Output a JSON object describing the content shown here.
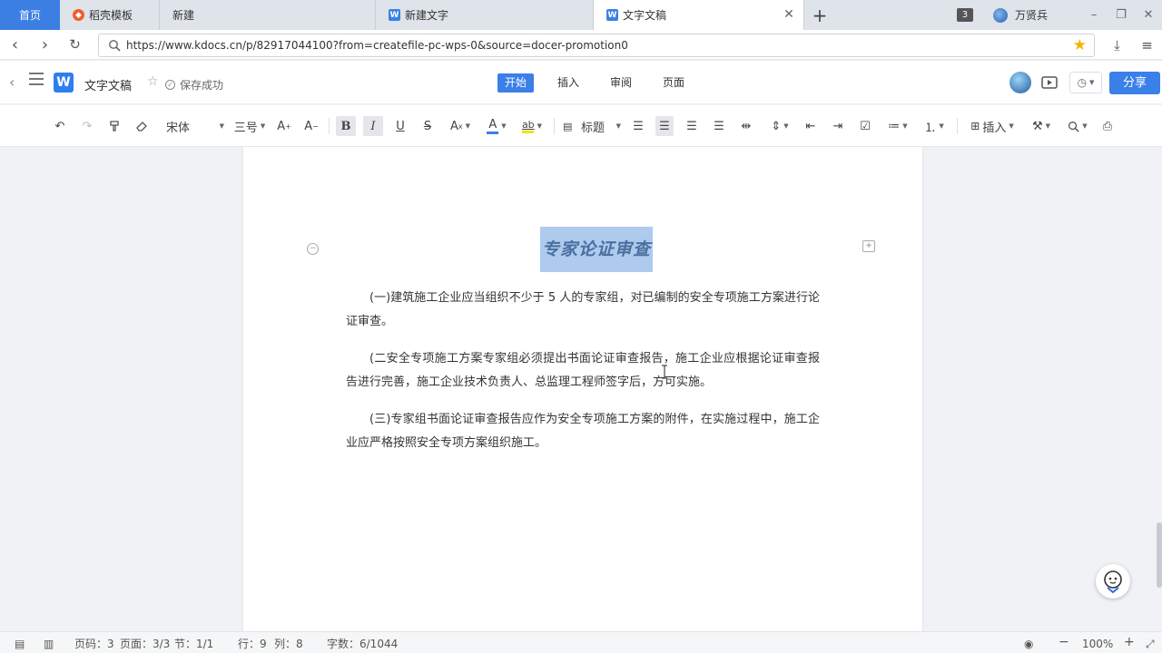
{
  "browser": {
    "tabs": [
      {
        "label": "首页",
        "active": false
      },
      {
        "label": "稻壳模板",
        "active": false,
        "icon": "docer-icon"
      },
      {
        "label": "新建",
        "active": false
      },
      {
        "label": "新建文字",
        "active": false,
        "icon": "wps-writer-icon"
      },
      {
        "label": "文字文稿",
        "active": true,
        "icon": "wps-writer-icon"
      }
    ],
    "new_tab_label": "+",
    "tab_count": "3",
    "username": "万贤兵",
    "url": "https://www.kdocs.cn/p/82917044100?from=createfile-pc-wps-0&source=docer-promotion0"
  },
  "app": {
    "doc_name": "文字文稿",
    "save_status": "保存成功",
    "menu_tabs": [
      "开始",
      "插入",
      "审阅",
      "页面"
    ],
    "active_menu": "开始",
    "share_label": "分享"
  },
  "ribbon": {
    "font_name": "宋体",
    "font_size": "三号",
    "style_label": "标题",
    "insert_label": "插入",
    "bold": "B",
    "italic": "I",
    "underline": "U",
    "strike": "S",
    "font_color_letter": "A",
    "highlight_letters": "ab",
    "font_color": "#3b7fe8",
    "highlight_color": "#f5e100"
  },
  "document": {
    "title": "专家论证审查",
    "paragraphs": [
      "(一)建筑施工企业应当组织不少于 5 人的专家组，对已编制的安全专项施工方案进行论证审查。",
      "(二安全专项施工方案专家组必须提出书面论证审查报告，施工企业应根据论证审查报告进行完善，施工企业技术负责人、总监理工程师签字后，方可实施。",
      "(三)专家组书面论证审查报告应作为安全专项施工方案的附件，在实施过程中，施工企业应严格按照安全专项方案组织施工。"
    ]
  },
  "status": {
    "page_code": "页码：3",
    "page": "页面：3/3",
    "section": "节：1/1",
    "row": "行：9",
    "col": "列：8",
    "word_count": "字数：6/1044",
    "zoom": "100%",
    "zoom_minus": "−",
    "zoom_plus": "+"
  }
}
